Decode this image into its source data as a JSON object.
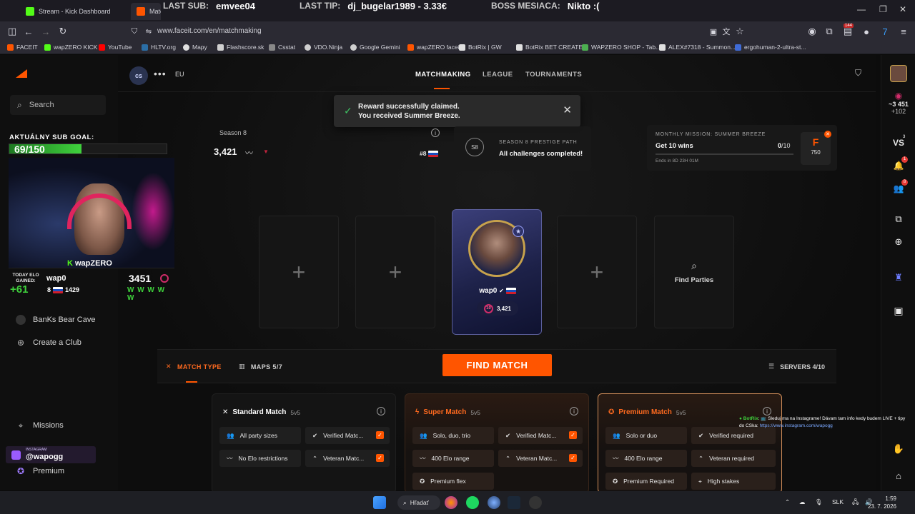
{
  "browser": {
    "tabs": [
      {
        "label": "Stream - Kick Dashboard"
      },
      {
        "label": "Matchmaking"
      }
    ],
    "url": "www.faceit.com/en/matchmaking",
    "bookmarks": [
      "FACEIT",
      "wapZERO KICK",
      "YouTube",
      "HLTV.org",
      "Mapy",
      "Flashscore.sk",
      "Csstat",
      "VDO.Ninja",
      "Google Gemini",
      "wapZERO faceit",
      "BotRix | GW",
      "BotRix BET CREATE",
      "WAPZERO SHOP - Tab...",
      "ALEX#7318 - Summon...",
      "ergohuman-2-ultra-st..."
    ],
    "badge_count": "144"
  },
  "stream_overlay": {
    "last_sub_label": "LAST SUB:",
    "last_sub_value": "emvee04",
    "last_tip_label": "LAST TIP:",
    "last_tip_value": "dj_bugelar1989 - 3.33€",
    "boss_label": "BOSS MESIACA:",
    "boss_value": "Nikto :(",
    "sub_goal_label": "AKTUÁLNY SUB GOAL:",
    "sub_goal_value": "69/150",
    "sub_goal_fraction": 0.46,
    "brand": "wapZERO",
    "today_elo_label": "TODAY ELO GAINED:",
    "today_elo_value": "+61",
    "player_name": "wap0",
    "elo": "3451",
    "rank": "8",
    "rank_elo": "1429",
    "recent_results": "W W W W W",
    "instagram_label": "INSTAGRAM",
    "instagram_handle": "@wapogg"
  },
  "sidebar": {
    "search_placeholder": "Search",
    "items": [
      {
        "label": "BanKs Bear Cave"
      },
      {
        "label": "Create a Club"
      },
      {
        "label": "Missions"
      },
      {
        "label": "Premium"
      }
    ]
  },
  "topnav": {
    "game": "cs",
    "region": "EU",
    "links": [
      "MATCHMAKING",
      "LEAGUE",
      "TOURNAMENTS"
    ],
    "active": "MATCHMAKING"
  },
  "toast": {
    "line1": "Reward successfully claimed.",
    "line2": "You received Summer Breeze."
  },
  "elo_panel": {
    "season": "Season 8",
    "elo": "3,421",
    "rank": "#8"
  },
  "prestige": {
    "badge": "S8",
    "title": "SEASON 8 PRESTIGE PATH",
    "status": "All challenges completed!"
  },
  "mission": {
    "title": "MONTHLY MISSION: SUMMER BREEZE",
    "task": "Get 10 wins",
    "progress_done": "0",
    "progress_total": "/10",
    "ends": "Ends in 8D 23H 01M",
    "points_icon": "F",
    "points": "750"
  },
  "party": {
    "player_name": "wap0",
    "player_level": "10",
    "player_elo": "3,421",
    "find_parties": "Find Parties"
  },
  "matchbar": {
    "match_type": "MATCH TYPE",
    "maps": "MAPS 5/7",
    "find_match": "FIND MATCH",
    "servers": "SERVERS 4/10"
  },
  "match_cards": [
    {
      "title": "Standard Match",
      "mode": "5v5",
      "features": [
        "All party sizes",
        "Verified Matc...",
        "No Elo restrictions",
        "Veteran Matc..."
      ]
    },
    {
      "title": "Super Match",
      "mode": "5v5",
      "features": [
        "Solo, duo, trio",
        "Verified Matc...",
        "400 Elo range",
        "Veteran Matc...",
        "Premium flex"
      ]
    },
    {
      "title": "Premium Match",
      "mode": "5v5",
      "features": [
        "Solo or duo",
        "Verified required",
        "400 Elo range",
        "Veteran required",
        "Premium Required",
        "High stakes"
      ]
    }
  ],
  "right_rail": {
    "points": "~3 451",
    "delta": "+102",
    "vs_label": "VS",
    "vs_badge": "3",
    "notif_badge": "1",
    "friends_badge": "8"
  },
  "chat": {
    "bot": "BotRix",
    "message": ": 📺 Sleduj ma na Instagrame! Dávam tam info kedy budem LIVE + tipy do CSka:",
    "link": "https://www.instagram.com/wapogg"
  },
  "taskbar": {
    "search": "Hľadať",
    "lang": "SLK",
    "time": "1:59",
    "date": "23. 7. 2026"
  }
}
